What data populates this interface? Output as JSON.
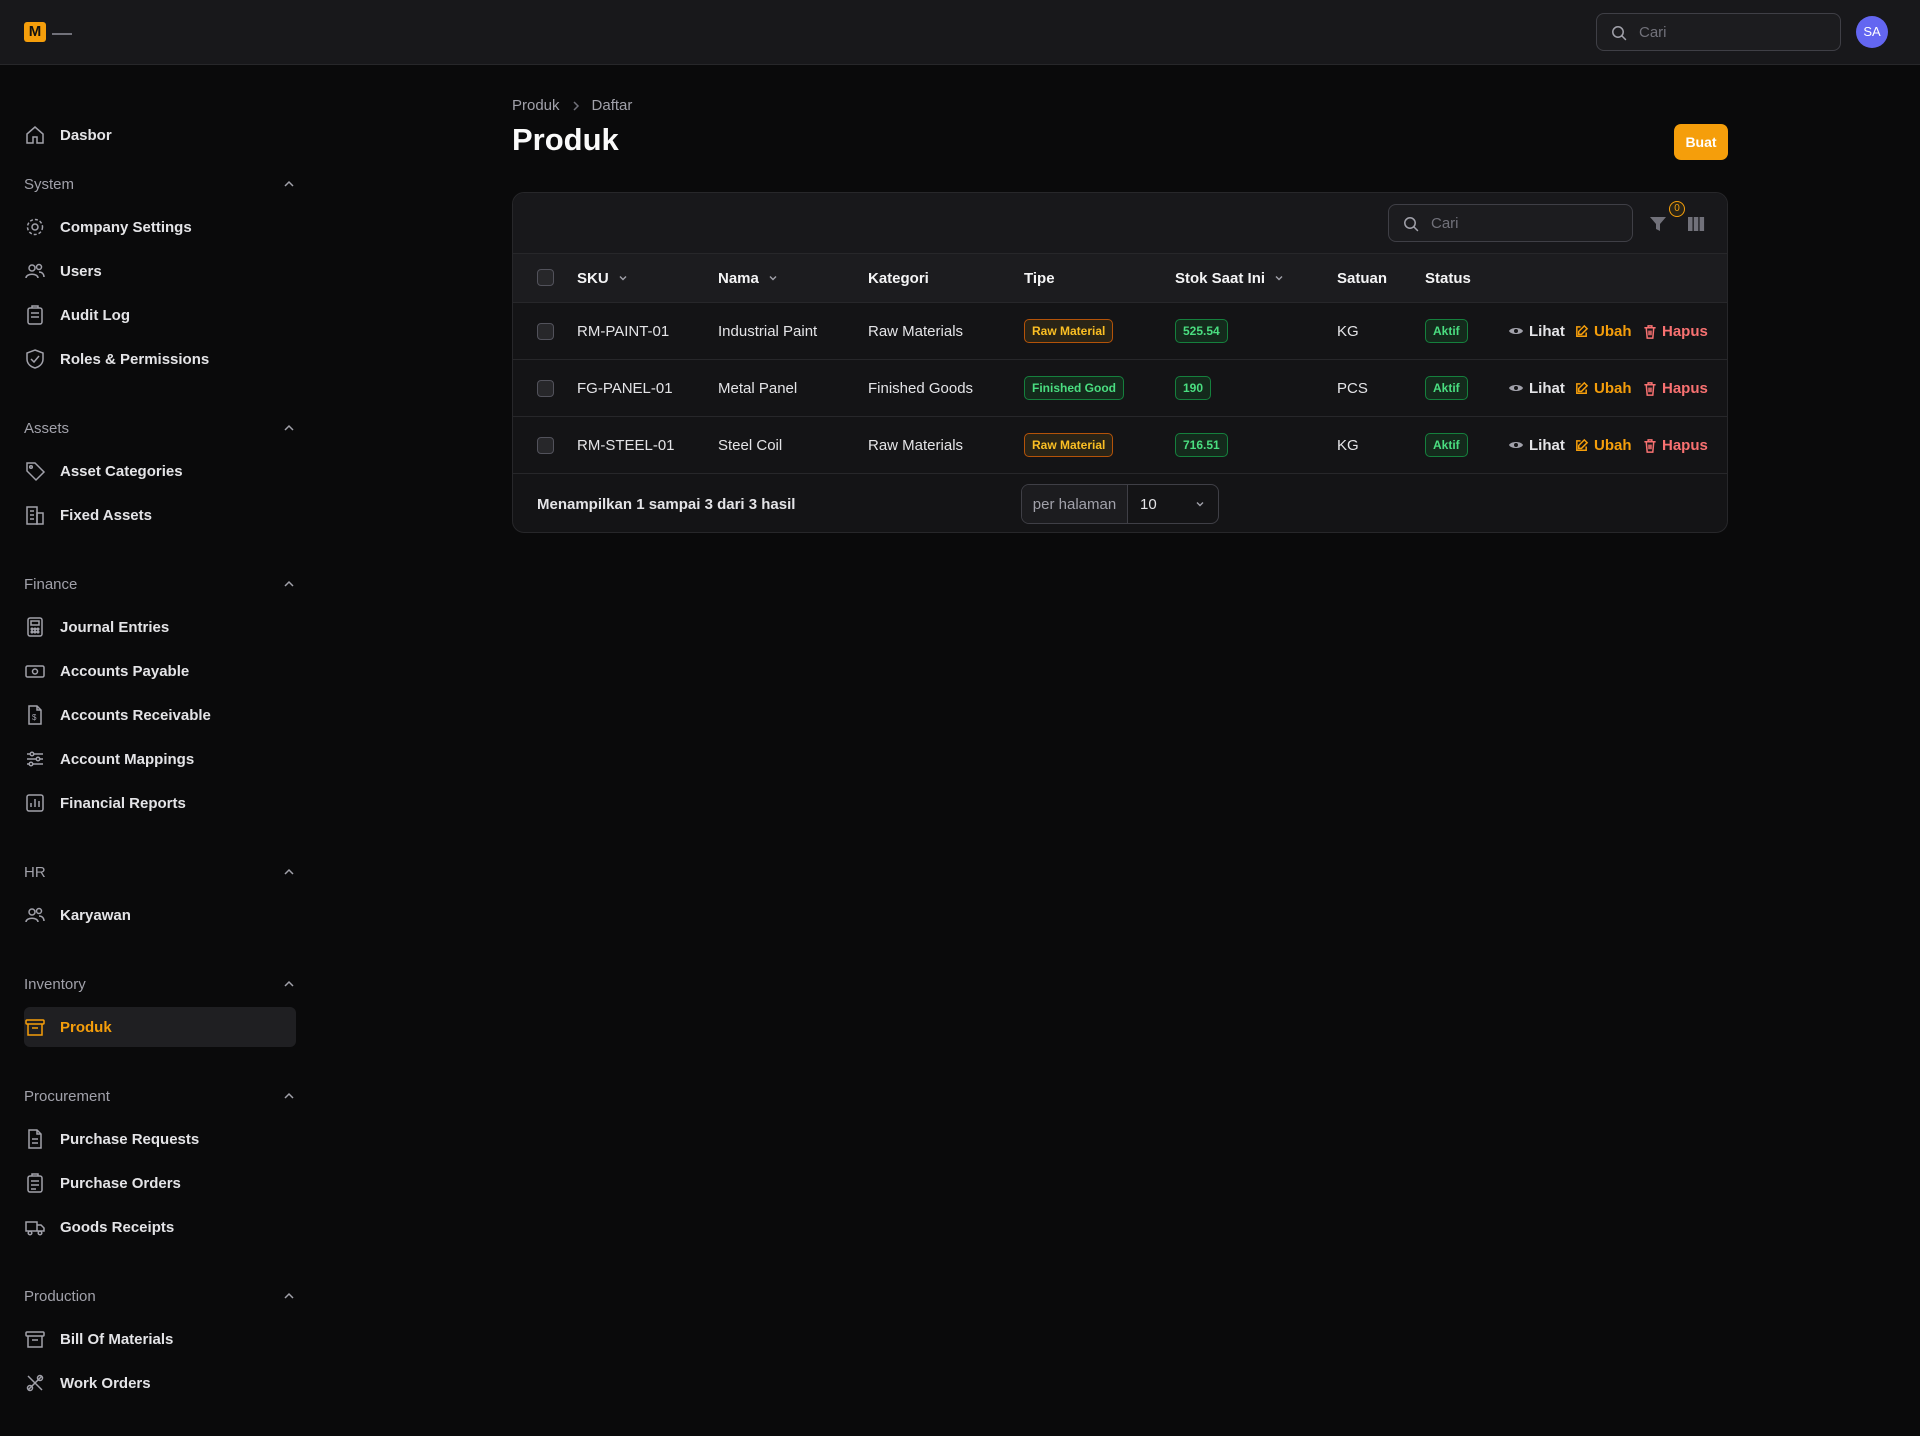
{
  "app": {
    "logo_letter": "M",
    "user_initials": "SA"
  },
  "topbar": {
    "search_placeholder": "Cari"
  },
  "sidebar": {
    "dashboard": "Dasbor",
    "groups": [
      {
        "label": "System",
        "items": [
          "Company Settings",
          "Users",
          "Audit Log",
          "Roles & Permissions"
        ]
      },
      {
        "label": "Assets",
        "items": [
          "Asset Categories",
          "Fixed Assets"
        ]
      },
      {
        "label": "Finance",
        "items": [
          "Journal Entries",
          "Accounts Payable",
          "Accounts Receivable",
          "Account Mappings",
          "Financial Reports"
        ]
      },
      {
        "label": "HR",
        "items": [
          "Karyawan"
        ]
      },
      {
        "label": "Inventory",
        "items": [
          "Produk"
        ]
      },
      {
        "label": "Procurement",
        "items": [
          "Purchase Requests",
          "Purchase Orders",
          "Goods Receipts"
        ]
      },
      {
        "label": "Production",
        "items": [
          "Bill Of Materials",
          "Work Orders"
        ]
      }
    ],
    "active_item": "Produk",
    "accent": "#f59e0b"
  },
  "breadcrumb": [
    "Produk",
    "Daftar"
  ],
  "page": {
    "title": "Produk",
    "create_label": "Buat"
  },
  "table": {
    "search_placeholder": "Cari",
    "filter_count": "0",
    "columns": [
      "SKU",
      "Nama",
      "Kategori",
      "Tipe",
      "Stok Saat Ini",
      "Satuan",
      "Status"
    ],
    "rows": [
      {
        "sku": "RM-PAINT-01",
        "name": "Industrial Paint",
        "category": "Raw Materials",
        "type": "Raw Material",
        "stock": "525.54",
        "unit": "KG",
        "status": "Aktif"
      },
      {
        "sku": "FG-PANEL-01",
        "name": "Metal Panel",
        "category": "Finished Goods",
        "type": "Finished Good",
        "stock": "190",
        "unit": "PCS",
        "status": "Aktif"
      },
      {
        "sku": "RM-STEEL-01",
        "name": "Steel Coil",
        "category": "Raw Materials",
        "type": "Raw Material",
        "stock": "716.51",
        "unit": "KG",
        "status": "Aktif"
      }
    ],
    "actions": {
      "view": "Lihat",
      "edit": "Ubah",
      "delete": "Hapus"
    },
    "summary": "Menampilkan 1 sampai 3 dari 3 hasil",
    "per_page_label": "per halaman",
    "per_page_value": "10"
  }
}
